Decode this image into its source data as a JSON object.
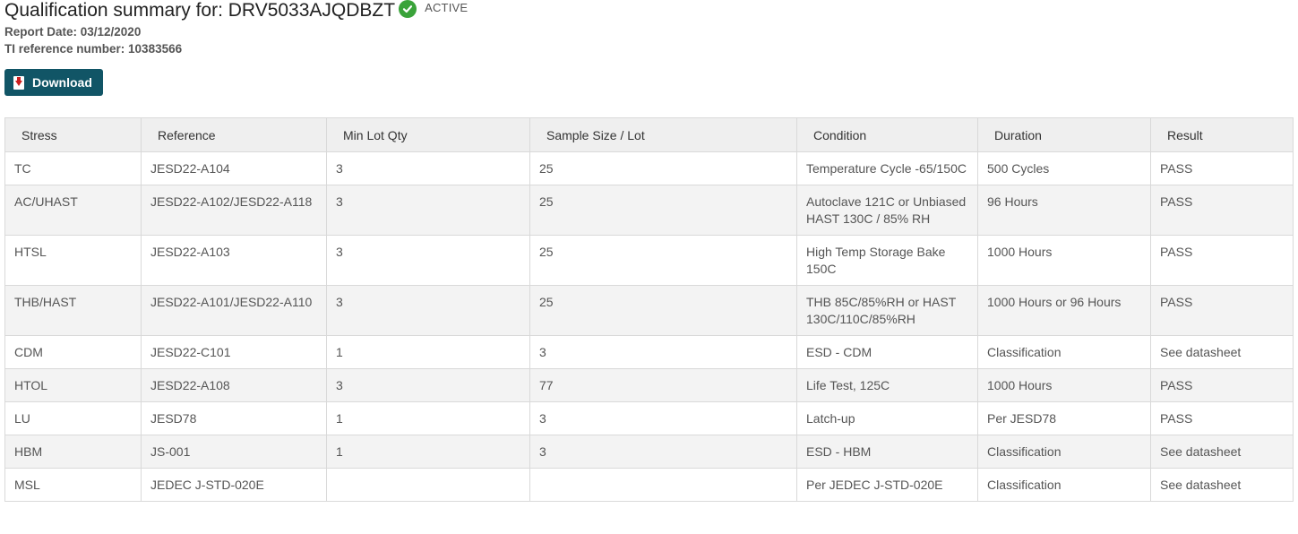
{
  "header": {
    "title": "Qualification summary for: DRV5033AJQDBZT",
    "status": "ACTIVE",
    "report_date": "Report Date: 03/12/2020",
    "reference_number": "TI reference number: 10383566",
    "status_icon": "check-circle-icon",
    "status_color": "#3aa33a"
  },
  "toolbar": {
    "download_label": "Download",
    "download_icon": "pdf-icon",
    "download_color": "#115566"
  },
  "table": {
    "columns": [
      "Stress",
      "Reference",
      "Min Lot Qty",
      "Sample Size / Lot",
      "Condition",
      "Duration",
      "Result"
    ],
    "rows": [
      {
        "stress": "TC",
        "reference": "JESD22-A104",
        "min_lot_qty": "3",
        "sample_size": "25",
        "condition": "Temperature Cycle -65/150C",
        "duration": "500 Cycles",
        "result": "PASS"
      },
      {
        "stress": "AC/UHAST",
        "reference": "JESD22-A102/JESD22-A118",
        "min_lot_qty": "3",
        "sample_size": "25",
        "condition": "Autoclave 121C or Unbiased HAST 130C / 85% RH",
        "duration": "96 Hours",
        "result": "PASS"
      },
      {
        "stress": "HTSL",
        "reference": "JESD22-A103",
        "min_lot_qty": "3",
        "sample_size": "25",
        "condition": "High Temp Storage Bake 150C",
        "duration": "1000 Hours",
        "result": "PASS"
      },
      {
        "stress": "THB/HAST",
        "reference": "JESD22-A101/JESD22-A110",
        "min_lot_qty": "3",
        "sample_size": "25",
        "condition": "THB 85C/85%RH or HAST 130C/110C/85%RH",
        "duration": "1000 Hours or 96 Hours",
        "result": "PASS"
      },
      {
        "stress": "CDM",
        "reference": "JESD22-C101",
        "min_lot_qty": "1",
        "sample_size": "3",
        "condition": "ESD - CDM",
        "duration": "Classification",
        "result": "See datasheet"
      },
      {
        "stress": "HTOL",
        "reference": "JESD22-A108",
        "min_lot_qty": "3",
        "sample_size": "77",
        "condition": "Life Test, 125C",
        "duration": "1000 Hours",
        "result": "PASS"
      },
      {
        "stress": "LU",
        "reference": "JESD78",
        "min_lot_qty": "1",
        "sample_size": "3",
        "condition": "Latch-up",
        "duration": "Per JESD78",
        "result": "PASS"
      },
      {
        "stress": "HBM",
        "reference": "JS-001",
        "min_lot_qty": "1",
        "sample_size": "3",
        "condition": "ESD - HBM",
        "duration": "Classification",
        "result": "See datasheet"
      },
      {
        "stress": "MSL",
        "reference": "JEDEC J-STD-020E",
        "min_lot_qty": "",
        "sample_size": "",
        "condition": "Per JEDEC J-STD-020E",
        "duration": "Classification",
        "result": "See datasheet"
      }
    ]
  }
}
